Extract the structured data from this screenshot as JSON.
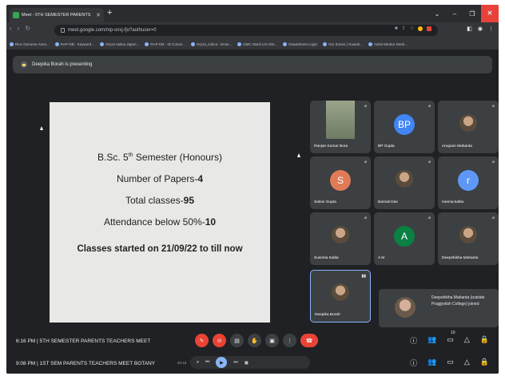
{
  "browser": {
    "tab_title": "Meet - 5TH SEMESTER PARENTS",
    "url": "meet.google.com/mp-snsj-fjo?authuser=0",
    "bookmarks": [
      "Rice Genome Anno...",
      "RAP-DB - Keyword...",
      "Oryza sativa Japon...",
      "RAP-DB - ID Conve...",
      "Oryza_indica - Ense...",
      "GMC Ward List 202...",
      "Department Login",
      "Our Zones | Guwah...",
      "Administrator Dash..."
    ]
  },
  "meet": {
    "presenting_text": "Deepika Borah is presenting",
    "slide": {
      "line1_prefix": "B.Sc. 5",
      "line1_sup": "th",
      "line1_suffix": " Semester (Honours)",
      "papers_label": "Number of Papers-",
      "papers_value": "4",
      "classes_label": "Total classes-",
      "classes_value": "95",
      "attendance_label": "Attendance below 50%-",
      "attendance_value": "10",
      "started": "Classes started on 21/09/22 to till now"
    },
    "participants": [
      {
        "name": "Ranjan Kumar Bora",
        "avatar": "",
        "color": "#3c4043",
        "kind": "video"
      },
      {
        "name": "BP Gupta",
        "avatar": "BP",
        "color": "#4285f4",
        "kind": "letter"
      },
      {
        "name": "Anupam Mahanta",
        "avatar": "",
        "color": "#3c4043",
        "kind": "photo"
      },
      {
        "name": "Saloni Gupta",
        "avatar": "S",
        "color": "#e07a57",
        "kind": "letter"
      },
      {
        "name": "Barnali Das",
        "avatar": "",
        "color": "#3c4043",
        "kind": "photo"
      },
      {
        "name": "meena kalita",
        "avatar": "r",
        "color": "#5e97f6",
        "kind": "letter"
      },
      {
        "name": "Susmita Kalita",
        "avatar": "",
        "color": "#3c4043",
        "kind": "photo"
      },
      {
        "name": "A M",
        "avatar": "A",
        "color": "#0b8043",
        "kind": "letter"
      },
      {
        "name": "Deepshikha Mahanta",
        "avatar": "",
        "color": "#3c4043",
        "kind": "photo"
      },
      {
        "name": "Deepika Borah",
        "avatar": "",
        "color": "#3c4043",
        "kind": "photo"
      }
    ],
    "toast": "Deepshikha Mahanta (outside Pragjyotish College) joined",
    "bottom_line1": "6:16 PM  |  5TH SEMESTER PARENTS TEACHERS MEET",
    "bottom_line2": "9:08 PM  |  1ST SEM PARENTS TEACHERS MEET BOTANY",
    "participant_count": "10",
    "timer": "40:18"
  }
}
